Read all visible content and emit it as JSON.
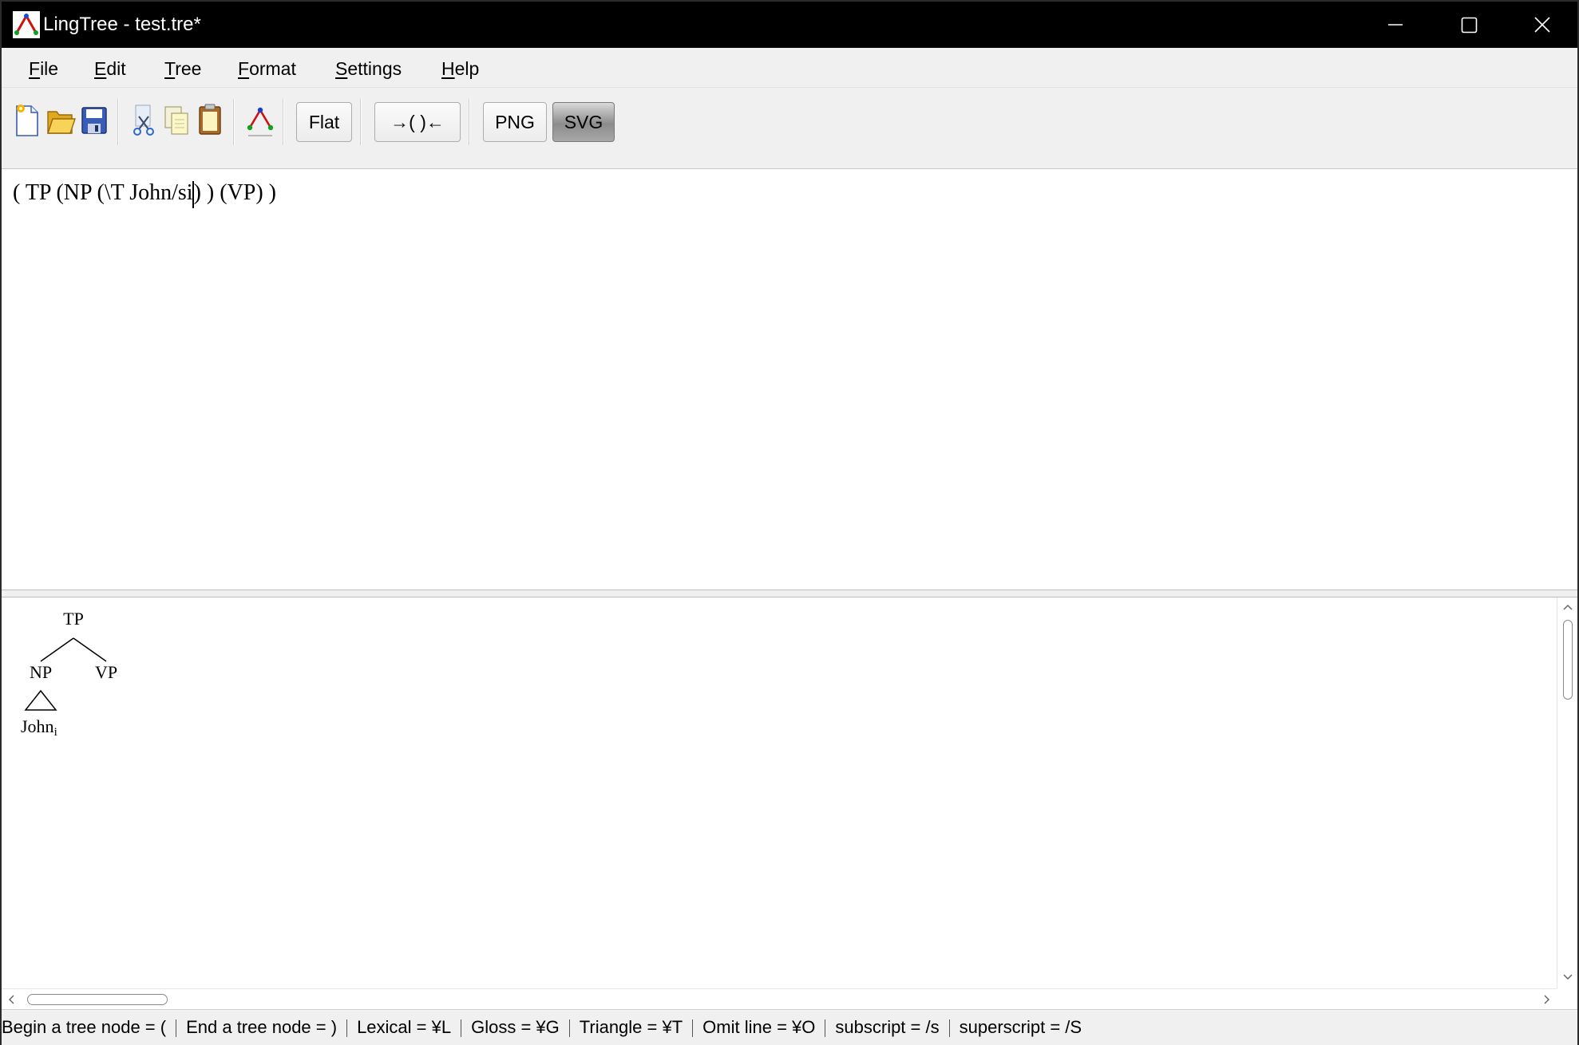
{
  "window": {
    "title": "LingTree - test.tre*"
  },
  "titlebar_controls": {
    "minimize_icon": "minimize-icon",
    "maximize_icon": "maximize-icon",
    "close_icon": "close-icon"
  },
  "menu": [
    {
      "mnemonic": "F",
      "rest": "ile"
    },
    {
      "mnemonic": "E",
      "rest": "dit"
    },
    {
      "mnemonic": "T",
      "rest": "ree"
    },
    {
      "mnemonic": "F",
      "rest": "ormat"
    },
    {
      "mnemonic": "S",
      "rest": "ettings"
    },
    {
      "mnemonic": "H",
      "rest": "elp"
    }
  ],
  "toolbar": {
    "icons": [
      "new-file-icon",
      "open-folder-icon",
      "save-icon",
      "cut-icon",
      "copy-icon",
      "paste-icon",
      "draw-tree-icon"
    ],
    "flat_label": "Flat",
    "indent_label": "→(  )←",
    "png_label": "PNG",
    "svg_label": "SVG"
  },
  "editor": {
    "text_before_caret": "( TP (NP (\\T John/si",
    "text_after_caret": ") ) (VP) )"
  },
  "tree": {
    "root": "TP",
    "left_child": "NP",
    "right_child": "VP",
    "leaf": "John",
    "leaf_subscript": "i"
  },
  "statusbar": {
    "items": [
      "Begin a tree node = (",
      "End a tree node = )",
      "Lexical = ¥L",
      "Gloss = ¥G",
      "Triangle = ¥T",
      "Omit line = ¥O",
      "subscript = /s",
      "superscript = /S"
    ]
  },
  "colors": {
    "titlebar": "#000000",
    "chrome": "#f0f0f0",
    "content": "#ffffff"
  }
}
